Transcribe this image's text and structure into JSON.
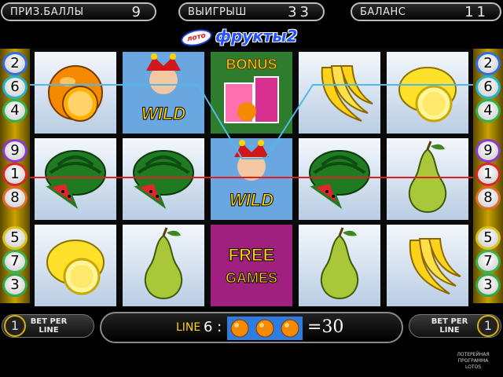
{
  "top": {
    "prize_label": "ПРИЗ.БАЛЛЫ",
    "prize_value": "9",
    "win_label": "ВЫИГРЫШ",
    "win_value": "33",
    "balance_label": "БАЛАНС",
    "balance_value": "11"
  },
  "logo": {
    "badge": "лото",
    "name": "фрукты2"
  },
  "left_badges": [
    {
      "num": "2",
      "color": "#2f6ee0"
    },
    {
      "num": "6",
      "color": "#23b3c9"
    },
    {
      "num": "4",
      "color": "#2fb24a"
    },
    {
      "num": "9",
      "color": "#8a3ad0"
    },
    {
      "num": "1",
      "color": "#d8262a"
    },
    {
      "num": "8",
      "color": "#e06a2a"
    },
    {
      "num": "5",
      "color": "#d8c21a"
    },
    {
      "num": "7",
      "color": "#3ab04a"
    },
    {
      "num": "3",
      "color": "#2fa84a"
    }
  ],
  "right_badges": [
    {
      "num": "2",
      "color": "#2f6ee0"
    },
    {
      "num": "6",
      "color": "#23b3c9"
    },
    {
      "num": "4",
      "color": "#2fb24a"
    },
    {
      "num": "9",
      "color": "#8a3ad0"
    },
    {
      "num": "1",
      "color": "#d8262a"
    },
    {
      "num": "8",
      "color": "#e06a2a"
    },
    {
      "num": "5",
      "color": "#d8c21a"
    },
    {
      "num": "7",
      "color": "#3ab04a"
    },
    {
      "num": "3",
      "color": "#2fa84a"
    }
  ],
  "reels": [
    [
      "orange-icon",
      "watermelon-icon",
      "lemon-icon"
    ],
    [
      "wild-joker-icon",
      "watermelon-icon",
      "pear-icon"
    ],
    [
      "bonus-icon",
      "wild-joker-icon",
      "free-games-icon"
    ],
    [
      "banana-icon",
      "watermelon-icon",
      "pear-icon"
    ],
    [
      "lemon-icon",
      "pear-icon",
      "banana-icon"
    ]
  ],
  "symbol_text": {
    "wild": "WILD",
    "bonus": "BONUS",
    "free": "FREE",
    "games": "GAMES"
  },
  "bottom": {
    "bet_per_line_label_1": "BET PER",
    "bet_per_line_label_2": "LINE",
    "bet_left": "1",
    "bet_right": "1",
    "line_label": "LINE",
    "line_number": "6 :",
    "line_win": "=30"
  },
  "brand": {
    "line1": "ЛОТЕРЕЙНАЯ",
    "line2": "ПРОГРАММА",
    "line3": "LOTOS"
  }
}
